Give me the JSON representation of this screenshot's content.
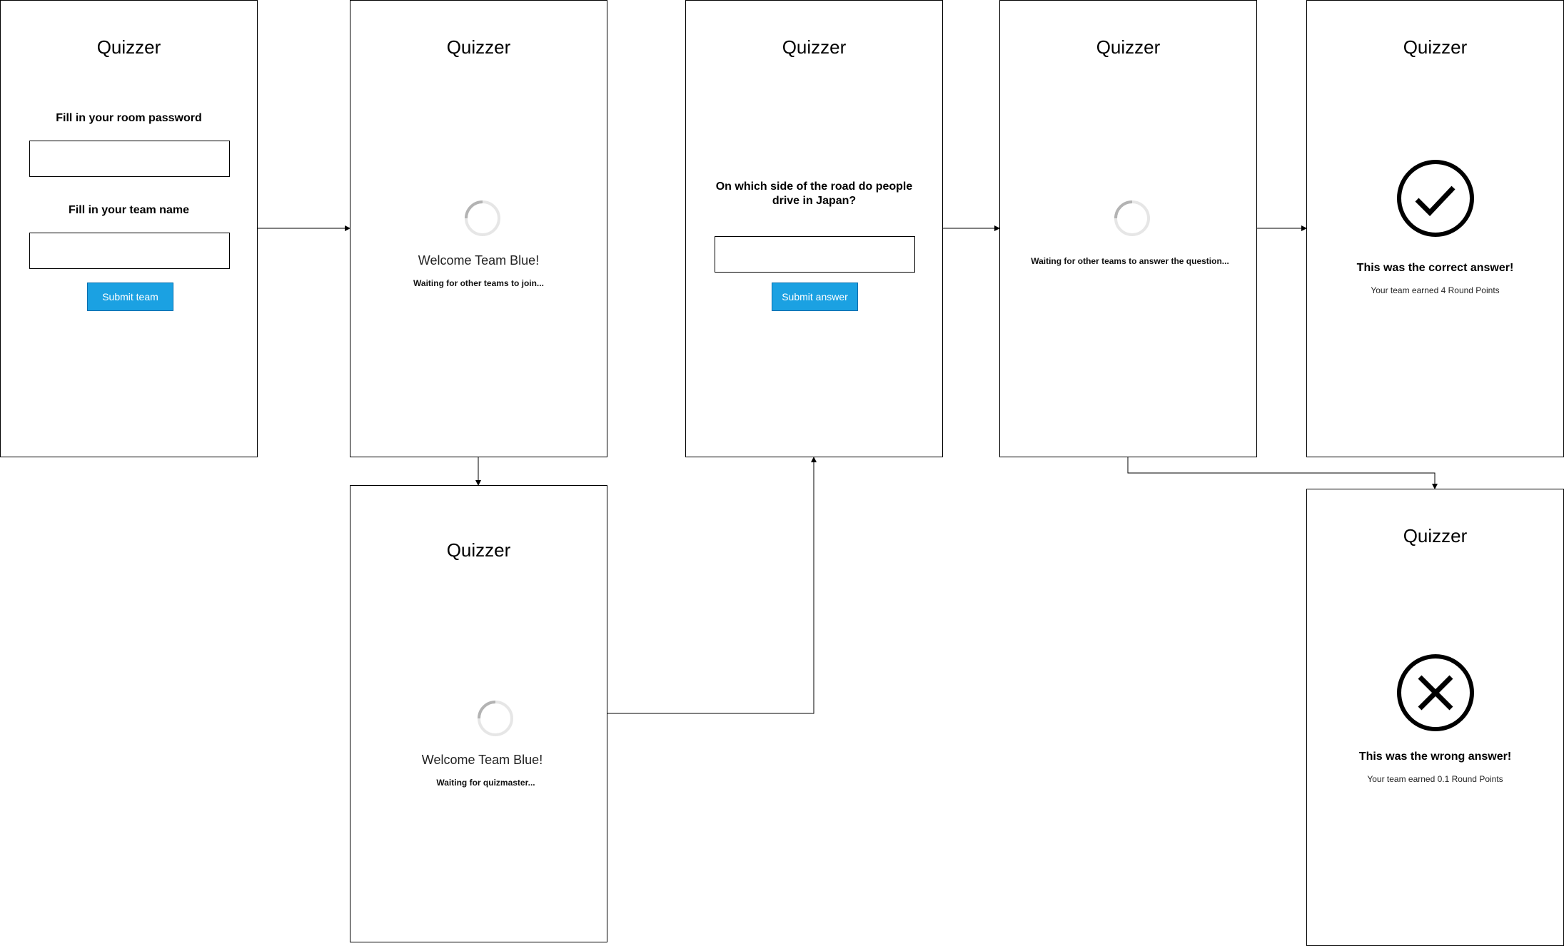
{
  "app_title": "Quizzer",
  "screens": {
    "join": {
      "password_label": "Fill in your room password",
      "team_label": "Fill in your team name",
      "submit_label": "Submit team"
    },
    "waiting_teams": {
      "welcome": "Welcome Team Blue!",
      "status": "Waiting for other teams to join..."
    },
    "waiting_quizmaster": {
      "welcome": "Welcome Team Blue!",
      "status": "Waiting for quizmaster..."
    },
    "question": {
      "question": "On which side of the road do people drive in Japan?",
      "submit_label": "Submit answer"
    },
    "waiting_answers": {
      "status": "Waiting for other teams to answer the question..."
    },
    "correct": {
      "icon": "check-circle-icon",
      "result": "This was the correct answer!",
      "points": "Your team earned 4 Round Points"
    },
    "wrong": {
      "icon": "x-circle-icon",
      "result": "This was the wrong answer!",
      "points": "Your team earned 0.1 Round Points"
    }
  },
  "colors": {
    "button": "#1ba1e2",
    "button_border": "#006eaf",
    "spinner_track": "#e6e6e6",
    "spinner_arc": "#b3b3b3"
  }
}
